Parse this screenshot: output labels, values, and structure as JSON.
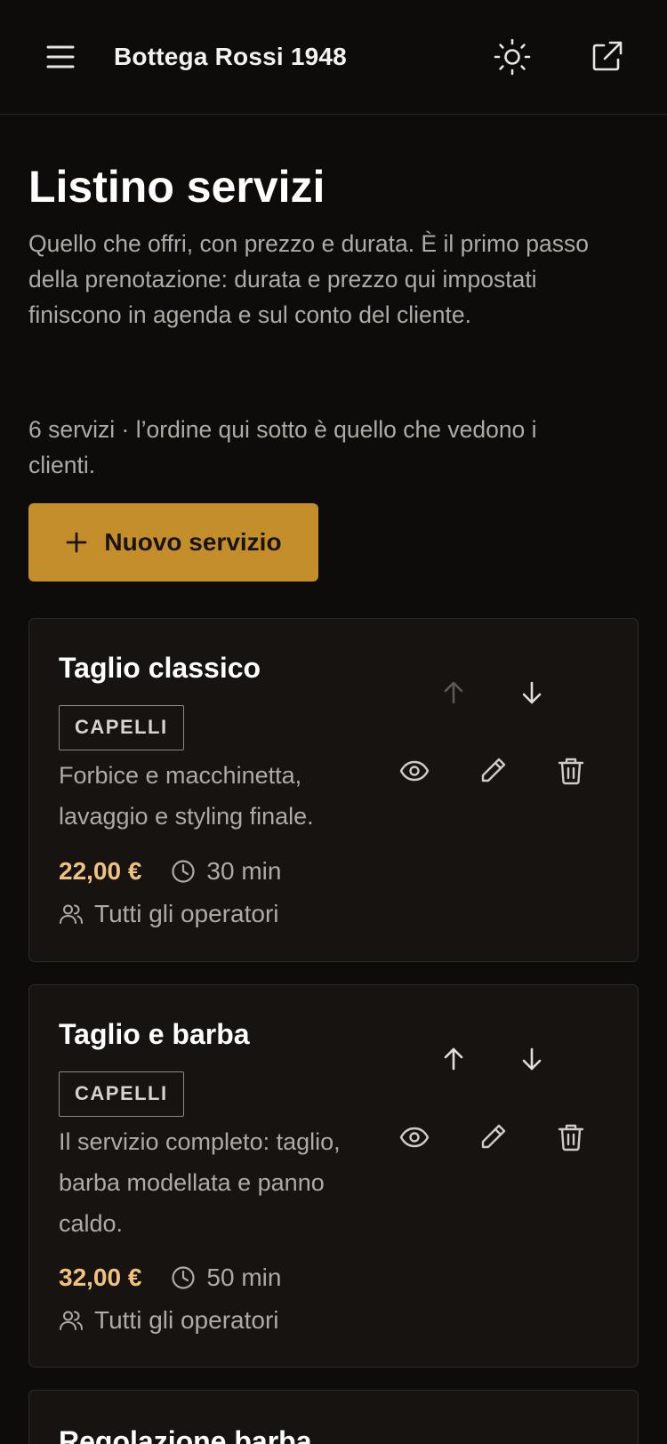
{
  "header": {
    "title": "Bottega Rossi 1948",
    "icons": [
      "menu-icon",
      "sun-icon",
      "external-link-icon"
    ]
  },
  "page": {
    "title": "Listino servizi",
    "intro": "Quello che offri, con prezzo e durata. È il primo passo della prenotazione: durata e prezzo qui impostati finiscono in agenda e sul conto del cliente.",
    "count": "6 servizi · l’ordine qui sotto è quello che vedono i clienti.",
    "new_button": "Nuovo servizio"
  },
  "services": [
    {
      "name": "Taglio classico",
      "tag": "CAPELLI",
      "description": "Forbice e macchinetta, lavaggio e styling finale.",
      "price": "22,00 €",
      "duration": "30 min",
      "operators": "Tutti gli operatori",
      "move_up_enabled": false
    },
    {
      "name": "Taglio e barba",
      "tag": "CAPELLI",
      "description": "Il servizio completo: taglio, barba modellata e panno caldo.",
      "price": "32,00 €",
      "duration": "50 min",
      "operators": "Tutti gli operatori",
      "move_up_enabled": true
    },
    {
      "name": "Regolazione barba"
    }
  ],
  "colors": {
    "background": "#0d0c0b",
    "card": "#161311",
    "accent": "#c48f2b",
    "price": "#f1c27a",
    "muted_text": "#aeaaa4"
  }
}
